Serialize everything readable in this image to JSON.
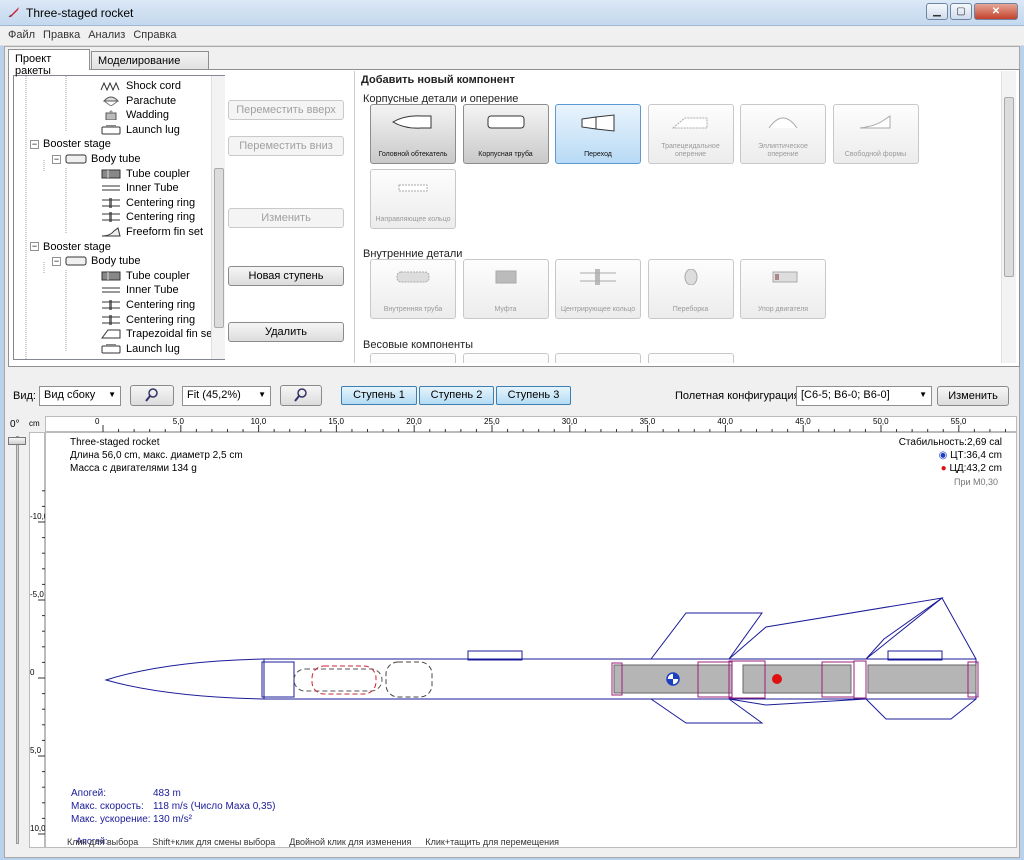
{
  "window": {
    "title": "Three-staged rocket",
    "minimize": "▁",
    "maximize": "▢",
    "close": "✕"
  },
  "menu": [
    "Файл",
    "Правка",
    "Анализ",
    "Справка"
  ],
  "tabs": [
    "Проект ракеты",
    "Моделирование полета"
  ],
  "tree": [
    {
      "label": "Shock cord",
      "icon": "shock-cord-icon"
    },
    {
      "label": "Parachute",
      "icon": "parachute-icon"
    },
    {
      "label": "Wadding",
      "icon": "wadding-icon"
    },
    {
      "label": "Launch lug",
      "icon": "launch-lug-icon"
    },
    {
      "label": "Booster stage",
      "icon": "stage-icon"
    },
    {
      "label": "Body tube",
      "icon": "body-tube-icon"
    },
    {
      "label": "Tube coupler",
      "icon": "tube-coupler-icon"
    },
    {
      "label": "Inner Tube",
      "icon": "inner-tube-icon"
    },
    {
      "label": "Centering ring",
      "icon": "centering-ring-icon"
    },
    {
      "label": "Centering ring",
      "icon": "centering-ring-icon"
    },
    {
      "label": "Freeform fin set",
      "icon": "freeform-fin-icon"
    },
    {
      "label": "Booster stage",
      "icon": "stage-icon"
    },
    {
      "label": "Body tube",
      "icon": "body-tube-icon"
    },
    {
      "label": "Tube coupler",
      "icon": "tube-coupler-icon"
    },
    {
      "label": "Inner Tube",
      "icon": "inner-tube-icon"
    },
    {
      "label": "Centering ring",
      "icon": "centering-ring-icon"
    },
    {
      "label": "Centering ring",
      "icon": "centering-ring-icon"
    },
    {
      "label": "Trapezoidal fin set",
      "icon": "trapezoidal-fin-icon"
    },
    {
      "label": "Launch lug",
      "icon": "launch-lug-icon"
    }
  ],
  "side_buttons": {
    "move_up": "Переместить вверх",
    "move_down": "Переместить вниз",
    "edit": "Изменить",
    "new_stage": "Новая ступень",
    "delete": "Удалить"
  },
  "add_panel": {
    "title": "Добавить новый компонент",
    "body_section": "Корпусные детали и оперение",
    "body_items": [
      {
        "label": "Головной обтекатель",
        "state": "enabled"
      },
      {
        "label": "Корпусная труба",
        "state": "enabled"
      },
      {
        "label": "Переход",
        "state": "selected"
      },
      {
        "label": "Трапецеидальное оперение",
        "state": "disabled"
      },
      {
        "label": "Эллиптическое оперение",
        "state": "disabled"
      },
      {
        "label": "Свободной формы",
        "state": "disabled"
      },
      {
        "label": "Направляющее кольцо",
        "state": "disabled"
      }
    ],
    "inner_section": "Внутренние детали",
    "inner_items": [
      {
        "label": "Внутренняя труба",
        "state": "disabled"
      },
      {
        "label": "Муфта",
        "state": "disabled"
      },
      {
        "label": "Центрирующее кольцо",
        "state": "disabled"
      },
      {
        "label": "Переборка",
        "state": "disabled"
      },
      {
        "label": "Упор двигателя",
        "state": "disabled"
      }
    ],
    "mass_section": "Весовые компоненты"
  },
  "view_toolbar": {
    "view_label": "Вид:",
    "view_value": "Вид сбоку",
    "zoom_value": "Fit (45,2%)",
    "stages": [
      "Ступень 1",
      "Ступень 2",
      "Ступень 3"
    ],
    "flight_config_label": "Полетная конфигурация:",
    "flight_config_value": "[C6-5; B6-0; B6-0]",
    "edit_button": "Изменить"
  },
  "angle_label": "0°",
  "ruler": {
    "unit": "cm",
    "h_ticks": [
      "0",
      "5,0",
      "10,0",
      "15,0",
      "20,0",
      "25,0",
      "30,0",
      "35,0",
      "40,0",
      "45,0",
      "50,0",
      "55,0"
    ],
    "v_ticks": [
      "-10,0",
      "-5,0",
      "0",
      "5,0",
      "10,0"
    ]
  },
  "rocket_info": {
    "name": "Three-staged rocket",
    "length": "Длина 56,0 cm, макс. диаметр 2,5 cm",
    "mass": "Масса с двигателями 134 g",
    "stability": "Стабильность:2,69 cal",
    "cg": "ЦТ:36,4 cm",
    "cp": "ЦД:43,2 cm",
    "mach": "При M0,30",
    "apogee_label": "Апогей:",
    "apogee_value": "483 m",
    "speed_label": "Макс. скорость:",
    "speed_value": "118 m/s  (Число Маха 0,35)",
    "accel_label": "Макс. ускорение:",
    "accel_value": "130 m/s²"
  },
  "status_hints": [
    "Клик для выбора",
    "Shift+клик для смены выбора",
    "Двойной клик для изменения",
    "Клик+тащить для перемещения"
  ],
  "colors": {
    "accent": "#3c7fb1",
    "rocket_outline": "#1b1b9a",
    "cg": "#1a3fbf",
    "cp": "#e01010",
    "magenta": "#9a1f7a"
  }
}
